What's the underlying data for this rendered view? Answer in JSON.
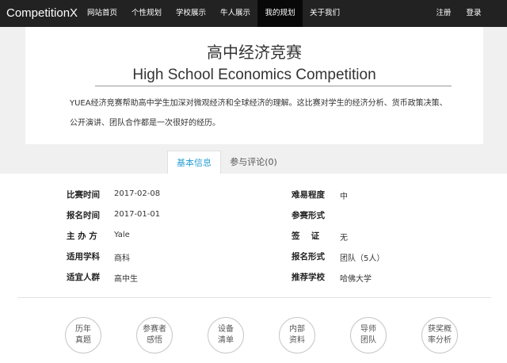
{
  "nav": {
    "brand": "CompetitionX",
    "items": [
      {
        "label": "网站首页"
      },
      {
        "label": "个性规划"
      },
      {
        "label": "学校展示"
      },
      {
        "label": "牛人展示"
      },
      {
        "label": "我的规划"
      },
      {
        "label": "关于我们"
      }
    ],
    "register": "注册",
    "login": "登录"
  },
  "hero": {
    "title_cn": "高中经济竞赛",
    "title_en": "High School Economics Competition",
    "description": "YUEA经济竞赛帮助高中学生加深对微观经济和全球经济的理解。这比赛对学生的经济分析、货币政策决策、公开演讲、团队合作都是一次很好的经历。"
  },
  "tabs": {
    "basic_info": "基本信息",
    "comments": "参与评论(0)"
  },
  "info": {
    "date_label": "比赛时间",
    "date_value": "2017-02-08",
    "difficulty_label": "难易程度",
    "difficulty_value": "中",
    "signup_label": "报名时间",
    "signup_value": "2017-01-01",
    "format_label": "参赛形式",
    "format_value": "",
    "host_label": "主 办 方",
    "host_value": "Yale",
    "visa_label": "签　 证",
    "visa_value": "无",
    "subject_label": "适用学科",
    "subject_value": "商科",
    "register_form_label": "报名形式",
    "register_form_value": "团队（5人）",
    "audience_label": "适宜人群",
    "audience_value": "高中生",
    "school_label": "推荐学校",
    "school_value": "哈佛大学"
  },
  "resources": {
    "past_papers": "历年\n真题",
    "experiences": "参赛者\n感悟",
    "equipment": "设备\n清单",
    "internal": "内部\n资料",
    "mentors": "导师\n团队",
    "award_odds": "获奖概\n率分析"
  }
}
